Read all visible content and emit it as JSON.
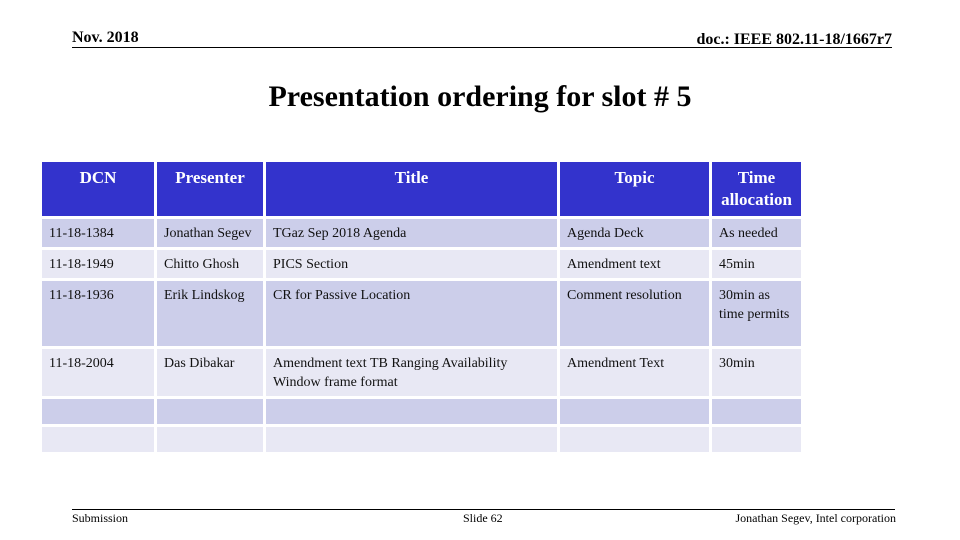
{
  "header": {
    "date": "Nov. 2018",
    "doc_id": "doc.: IEEE 802.11-18/1667r7"
  },
  "slide_title": "Presentation ordering for slot # 5",
  "table": {
    "columns": [
      "DCN",
      "Presenter",
      "Title",
      "Topic",
      "Time allocation"
    ],
    "rows": [
      {
        "dcn": "11-18-1384",
        "presenter": "Jonathan Segev",
        "title": "TGaz Sep 2018 Agenda",
        "topic": "Agenda Deck",
        "time": "As needed"
      },
      {
        "dcn": "11-18-1949",
        "presenter": "Chitto Ghosh",
        "title": "PICS Section",
        "topic": "Amendment text",
        "time": "45min"
      },
      {
        "dcn": "11-18-1936",
        "presenter": "Erik Lindskog",
        "title": "CR for Passive Location",
        "topic": "Comment resolution",
        "time": "30min as time permits"
      },
      {
        "dcn": "11-18-2004",
        "presenter": "Das Dibakar",
        "title": "Amendment text TB Ranging Availability Window frame format",
        "topic": "Amendment Text",
        "time": "30min"
      },
      {
        "dcn": "",
        "presenter": "",
        "title": "",
        "topic": "",
        "time": ""
      },
      {
        "dcn": "",
        "presenter": "",
        "title": "",
        "topic": "",
        "time": ""
      }
    ]
  },
  "footer": {
    "left": "Submission",
    "center": "Slide 62",
    "right": "Jonathan Segev, Intel corporation"
  },
  "colors": {
    "header_fill": "#3333cc",
    "row_odd": "#ccceea",
    "row_even": "#e8e8f4"
  }
}
